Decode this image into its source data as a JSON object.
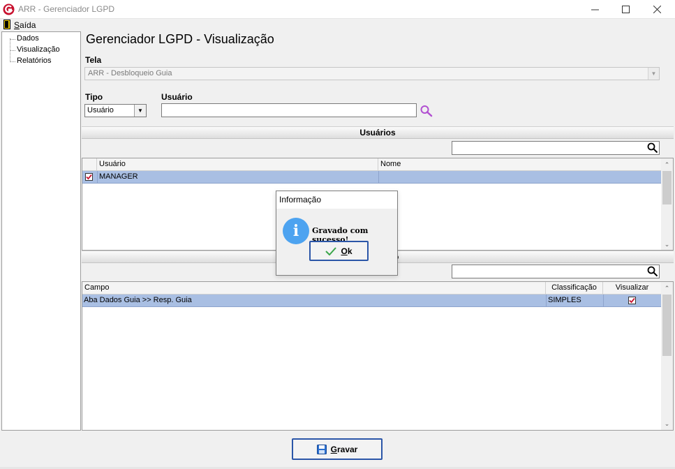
{
  "window": {
    "title": "ARR - Gerenciador LGPD",
    "icon": "app-logo-icon",
    "controls": [
      "minimize-icon",
      "maximize-icon",
      "close-icon"
    ]
  },
  "menu": {
    "exit_prefix": "S",
    "exit_rest": "aída"
  },
  "tree": {
    "items": [
      {
        "label": "Dados"
      },
      {
        "label": "Visualização"
      },
      {
        "label": "Relatórios"
      }
    ]
  },
  "main": {
    "title": "Gerenciador LGPD - Visualização",
    "tela_label": "Tela",
    "tela_value": "ARR - Desbloqueio Guia",
    "tipo_label": "Tipo",
    "tipo_value": "Usuário",
    "usuario_label": "Usuário",
    "usuario_value": ""
  },
  "users_section": {
    "title": "Usuários",
    "filter_value": "",
    "columns": [
      "Usuário",
      "Nome"
    ],
    "rows": [
      {
        "checked": true,
        "usuario": "MANAGER",
        "nome": ""
      }
    ]
  },
  "fields_section": {
    "title_visible_fragment": "o",
    "filter_value": "",
    "columns": [
      "Campo",
      "Classificação",
      "Visualizar"
    ],
    "rows": [
      {
        "campo": "Aba Dados Guia >> Resp. Guia",
        "classificacao": "SIMPLES",
        "visualizar": true
      }
    ]
  },
  "dialog": {
    "title": "Informação",
    "message": "Gravado com sucesso!",
    "ok_prefix": "O",
    "ok_rest": "k",
    "icon": "info-icon"
  },
  "footer": {
    "gravar_prefix": "G",
    "gravar_rest": "ravar"
  },
  "colors": {
    "selection": "#a9bfe3",
    "button_border": "#2b56a8",
    "info_icon": "#4da3f0",
    "check": "#c8102e",
    "search_icon": "#b14fd1"
  }
}
